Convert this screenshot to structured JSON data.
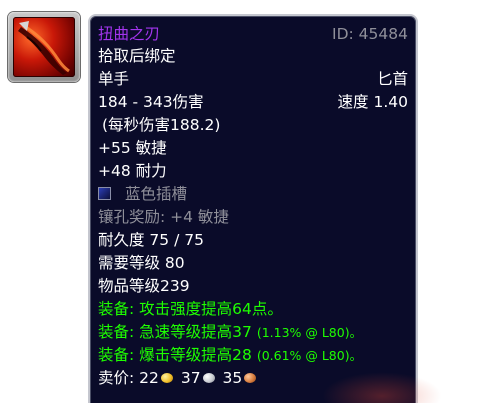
{
  "item": {
    "name": "扭曲之刃",
    "id_text": "ID: 45484",
    "bind": "拾取后绑定",
    "hand": "单手",
    "weapon_type": "匕首",
    "damage": "184 - 343伤害",
    "speed": "速度 1.40",
    "dps": "(每秒伤害188.2)",
    "agility": "+55 敏捷",
    "stamina": "+48 耐力",
    "socket": "蓝色插槽",
    "socket_bonus": "镶孔奖励: +4 敏捷",
    "durability": "耐久度 75 / 75",
    "required_level": "需要等级 80",
    "item_level": "物品等级239",
    "equip_1": "装备:  攻击强度提高64点。",
    "equip_2_main": "装备:  急速等级提高37",
    "equip_2_note": "(1.13% @ L80)。",
    "equip_3_main": "装备:  爆击等级提高28",
    "equip_3_note": "(0.61% @ L80)。",
    "sell_label": "卖价:",
    "gold": "22",
    "silver": "37",
    "copper": "35"
  },
  "colors": {
    "epic": "#a335ee",
    "green": "#1eff00",
    "grey": "#8f8f99",
    "background": "#0a0b29"
  },
  "icons": {
    "item": "twisted-dagger-icon",
    "socket": "blue-socket-icon",
    "gold": "gold-coin-icon",
    "silver": "silver-coin-icon",
    "copper": "copper-coin-icon"
  }
}
